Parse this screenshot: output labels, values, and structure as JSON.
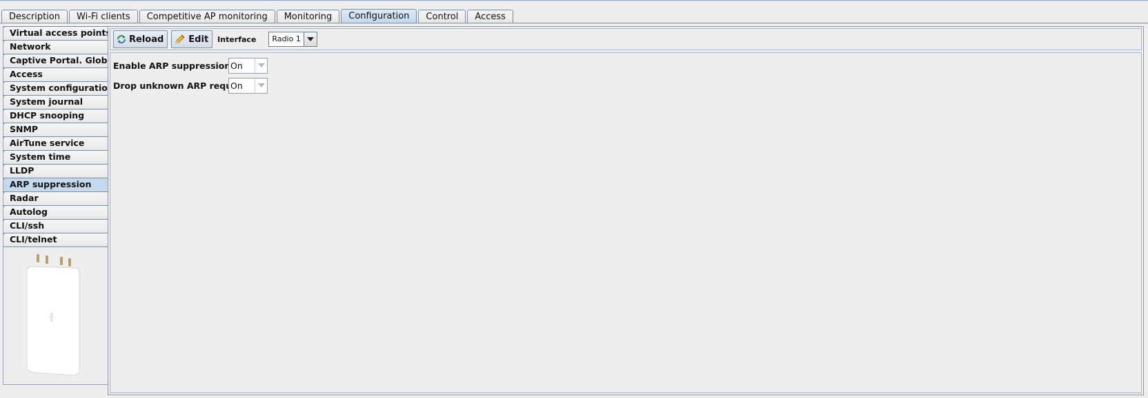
{
  "top_tabs": [
    {
      "label": "Description"
    },
    {
      "label": "Wi-Fi clients"
    },
    {
      "label": "Competitive AP monitoring"
    },
    {
      "label": "Monitoring"
    },
    {
      "label": "Configuration",
      "active": true
    },
    {
      "label": "Control"
    },
    {
      "label": "Access"
    }
  ],
  "sidebar": {
    "items": [
      {
        "label": "Virtual access points"
      },
      {
        "label": "Network"
      },
      {
        "label": "Captive Portal. Global"
      },
      {
        "label": "Access"
      },
      {
        "label": "System configuration"
      },
      {
        "label": "System journal"
      },
      {
        "label": "DHCP snooping"
      },
      {
        "label": "SNMP"
      },
      {
        "label": "AirTune service"
      },
      {
        "label": "System time"
      },
      {
        "label": "LLDP"
      },
      {
        "label": "ARP suppression",
        "active": true
      },
      {
        "label": "Radar"
      },
      {
        "label": "Autolog"
      },
      {
        "label": "CLI/ssh"
      },
      {
        "label": "CLI/telnet"
      }
    ]
  },
  "toolbar": {
    "reload_label": "Reload",
    "edit_label": "Edit",
    "interface_label": "Interface",
    "interface_value": "Radio 1",
    "icons": {
      "reload": "refresh-icon",
      "edit": "pencil-icon"
    }
  },
  "form": {
    "enable_arp_label": "Enable ARP suppression",
    "enable_arp_value": "On",
    "drop_unknown_label": "Drop unknown ARP requests",
    "drop_unknown_value": "On"
  },
  "colors": {
    "active_tab": "#c3d8ef",
    "active_sidebar": "#c5d9ee",
    "border": "#7d8a99"
  }
}
